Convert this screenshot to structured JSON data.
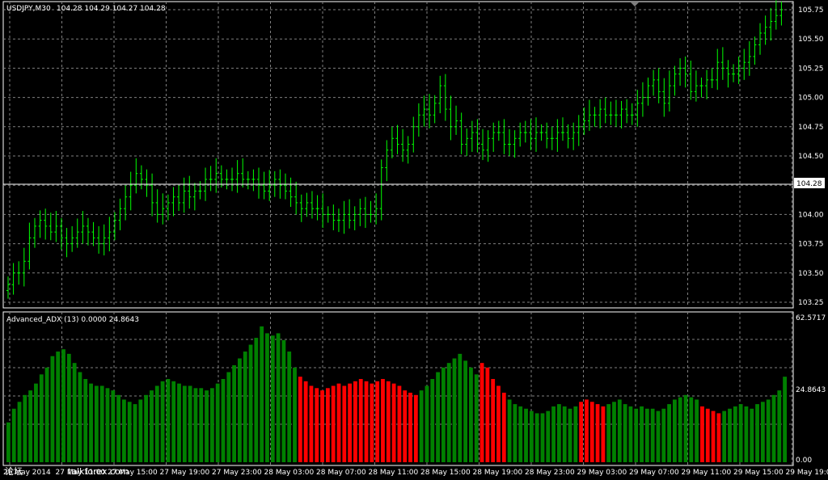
{
  "header": {
    "symbol_label": "USDJPY,M30",
    "ohlc_label": "104.28 104.29 104.27 104.28"
  },
  "indicator": {
    "label": "Advanced_ADX (13) 0.0000 24.8643",
    "max_label": "62.5717",
    "min_label": "0.00",
    "mid_label": "24.8643"
  },
  "watermark": {
    "text_prefix": "论坛",
    "text_main": "talkforex.com"
  },
  "colors": {
    "background": "#000000",
    "grid": "#7f7f7f",
    "bar_up": "#00ff00",
    "adx_green": "#008000",
    "adx_red": "#ff0000",
    "price_line": "#ffffff",
    "separator": "#ffffff"
  },
  "chart_data": [
    {
      "type": "ohlc",
      "title": "USDJPY,M30",
      "ylim": [
        103.2,
        105.8
      ],
      "y_ticks": [
        "105.75",
        "105.50",
        "105.25",
        "105.00",
        "104.75",
        "104.50",
        "104.25",
        "104.00",
        "103.75",
        "103.50",
        "103.25"
      ],
      "current_price": "104.28",
      "grid": true,
      "close": [
        103.4,
        103.5,
        103.5,
        103.6,
        103.8,
        103.9,
        103.95,
        103.9,
        103.85,
        103.9,
        103.8,
        103.75,
        103.8,
        103.85,
        103.9,
        103.85,
        103.8,
        103.75,
        103.8,
        103.85,
        103.95,
        104.05,
        104.15,
        104.25,
        104.35,
        104.3,
        104.25,
        104.1,
        104.0,
        104.05,
        104.1,
        104.15,
        104.1,
        104.2,
        104.15,
        104.2,
        104.2,
        104.3,
        104.3,
        104.35,
        104.3,
        104.3,
        104.3,
        104.35,
        104.3,
        104.3,
        104.3,
        104.25,
        104.2,
        104.25,
        104.3,
        104.25,
        104.2,
        104.15,
        104.1,
        104.05,
        104.1,
        104.05,
        104.05,
        104.0,
        104.0,
        103.95,
        103.95,
        104.0,
        103.95,
        104.0,
        104.05,
        104.0,
        104.0,
        104.05,
        104.4,
        104.55,
        104.65,
        104.6,
        104.55,
        104.6,
        104.75,
        104.85,
        104.9,
        104.85,
        104.95,
        105.1,
        104.9,
        104.75,
        104.8,
        104.6,
        104.65,
        104.7,
        104.6,
        104.55,
        104.65,
        104.7,
        104.7,
        104.6,
        104.6,
        104.65,
        104.7,
        104.7,
        104.65,
        104.7,
        104.7,
        104.65,
        104.65,
        104.7,
        104.7,
        104.65,
        104.7,
        104.75,
        104.8,
        104.85,
        104.85,
        104.9,
        104.85,
        104.85,
        104.85,
        104.9,
        104.85,
        104.85,
        104.95,
        105.0,
        105.1,
        105.15,
        105.05,
        104.95,
        105.1,
        105.2,
        105.25,
        105.2,
        105.05,
        105.1,
        105.1,
        105.15,
        105.15,
        105.3,
        105.25,
        105.2,
        105.2,
        105.25,
        105.3,
        105.35,
        105.45,
        105.55,
        105.6,
        105.65,
        105.7,
        105.75
      ]
    },
    {
      "type": "bar",
      "title": "Advanced_ADX (13) 0.0000 24.8643",
      "ylim": [
        0,
        62.5717
      ],
      "series": [
        {
          "values": [
            16,
            22,
            25,
            28,
            30,
            33,
            37,
            40,
            45,
            47,
            48,
            46,
            42,
            38,
            35,
            33,
            32,
            32,
            31,
            30,
            28,
            26,
            25,
            24,
            26,
            28,
            30,
            32,
            34,
            35,
            34,
            33,
            32,
            32,
            31,
            31,
            30,
            31,
            33,
            35,
            38,
            41,
            44,
            47,
            50,
            53,
            58,
            55,
            54,
            55,
            52,
            47,
            40
          ]
        },
        {
          "values": [
            36,
            34,
            32,
            31,
            30,
            31,
            32,
            33,
            32,
            33,
            34,
            35,
            34,
            33,
            34,
            35,
            34,
            33,
            32,
            30,
            29,
            28
          ]
        },
        {
          "values": [
            30,
            32,
            35,
            38,
            40,
            42,
            44,
            46,
            43,
            40,
            37
          ]
        },
        {
          "values": [
            42,
            40,
            35,
            32,
            29
          ]
        },
        {
          "values": [
            26,
            24,
            23,
            22,
            21,
            20,
            20,
            21,
            23,
            24,
            23,
            22,
            23
          ]
        },
        {
          "values": [
            25,
            26,
            25,
            24,
            23
          ]
        },
        {
          "values": [
            24,
            25,
            26,
            24,
            23,
            22,
            23,
            22,
            22,
            21,
            22,
            24,
            26,
            27,
            28,
            27,
            26
          ]
        },
        {
          "values": [
            23,
            22,
            21,
            20
          ]
        },
        {
          "values": [
            21,
            22,
            23,
            24,
            23,
            22,
            24,
            25,
            26,
            28,
            30,
            36
          ]
        }
      ],
      "series_colors": [
        "green",
        "red",
        "green",
        "red",
        "green",
        "red",
        "green",
        "red",
        "green"
      ]
    }
  ],
  "time_axis": {
    "labels": [
      "26 May 2014",
      "27 May 11:00",
      "27 May 15:00",
      "27 May 19:00",
      "27 May 23:00",
      "28 May 03:00",
      "28 May 07:00",
      "28 May 11:00",
      "28 May 15:00",
      "28 May 19:00",
      "28 May 23:00",
      "29 May 03:00",
      "29 May 07:00",
      "29 May 11:00",
      "29 May 15:00",
      "29 May 19:00"
    ]
  }
}
